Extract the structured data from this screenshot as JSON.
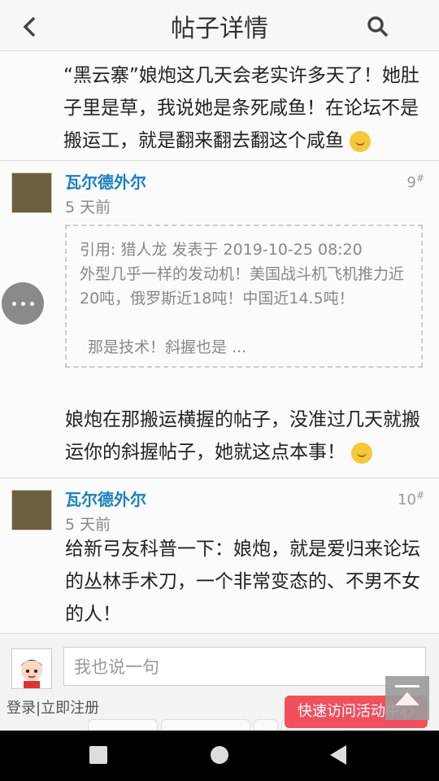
{
  "header": {
    "title": "帖子详情",
    "back_icon": "chevron-left-icon",
    "search_icon": "search-icon"
  },
  "post_tail": {
    "text": "“黑云寨”娘炮这几天会老实许多天了！她肚子里是草，我说她是条死咸鱼！在论坛不是搬运工，就是翻来翻去翻这个咸鱼"
  },
  "posts": [
    {
      "author": "瓦尔德外尔",
      "time": "5 天前",
      "floor": "9",
      "floor_sup": "#",
      "quote": {
        "header": "引用: 猎人龙 发表于 2019-10-25 08:20",
        "line1": "外型几乎一样的发动机！美国战斗机飞机推力近",
        "line2": "20吨，俄罗斯近18吨！中国近14.5吨！",
        "line3": "那是技术！斜握也是 ..."
      },
      "body": "娘炮在那搬运横握的帖子，没准过几天就搬运你的斜握帖子，她就这点本事！"
    },
    {
      "author": "瓦尔德外尔",
      "time": "5 天前",
      "floor": "10",
      "floor_sup": "#",
      "body": "给新弓友科普一下：娘炮，就是爱归来论坛的丛林手术刀，一个非常变态的、不男不女的人！"
    }
  ],
  "reply": {
    "placeholder": "我也说一句"
  },
  "footer": {
    "login": "登录",
    "sep": "|",
    "register": "立即注册",
    "quick_access": "快速访问活动中心"
  },
  "colors": {
    "link": "#1a7fc1",
    "quick_access_bg": "#f0505e"
  }
}
